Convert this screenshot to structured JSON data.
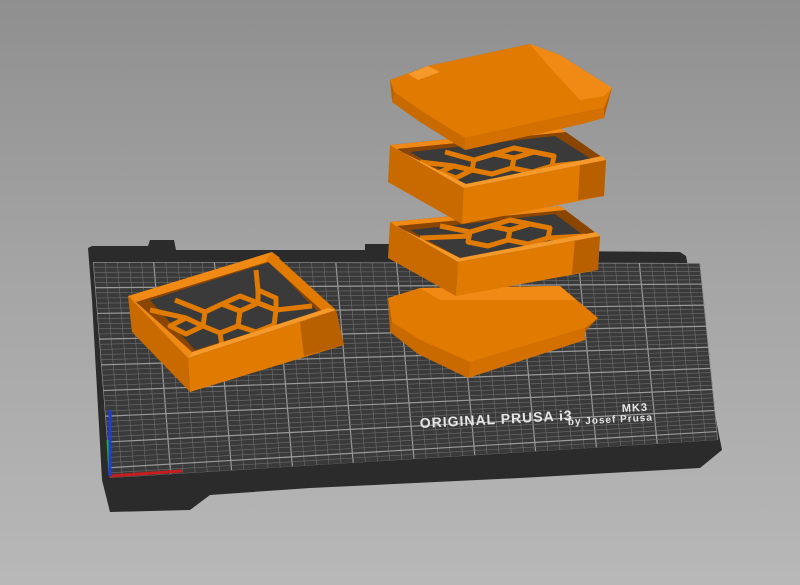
{
  "app": {
    "view": "3D plater view"
  },
  "printer": {
    "bed_brand": "ORIGINAL PRUSA i3",
    "bed_model": "MK3",
    "bed_byline": "by Josef Prusa"
  },
  "colors": {
    "background_top": "#8f8f8f",
    "background_bottom": "#b8b8b8",
    "bed_frame": "#2b2b2b",
    "bed_surface": "#3a3a3a",
    "grid_line": "#6e6e6e",
    "grid_major": "#9a9a9a",
    "model_orange": "#e07a00",
    "model_orange_dark": "#b85f00",
    "model_orange_light": "#f08a14",
    "axis_x": "#c81e1e",
    "axis_y": "#1eb41e",
    "axis_z": "#1e3cdc"
  },
  "objects": [
    {
      "name": "hex-box-bottom-on-bed"
    },
    {
      "name": "lid-top"
    },
    {
      "name": "hex-grid-tier-upper"
    },
    {
      "name": "hex-grid-tier-lower"
    },
    {
      "name": "base-plate"
    }
  ],
  "axes": [
    "x-axis",
    "y-axis",
    "z-axis"
  ]
}
